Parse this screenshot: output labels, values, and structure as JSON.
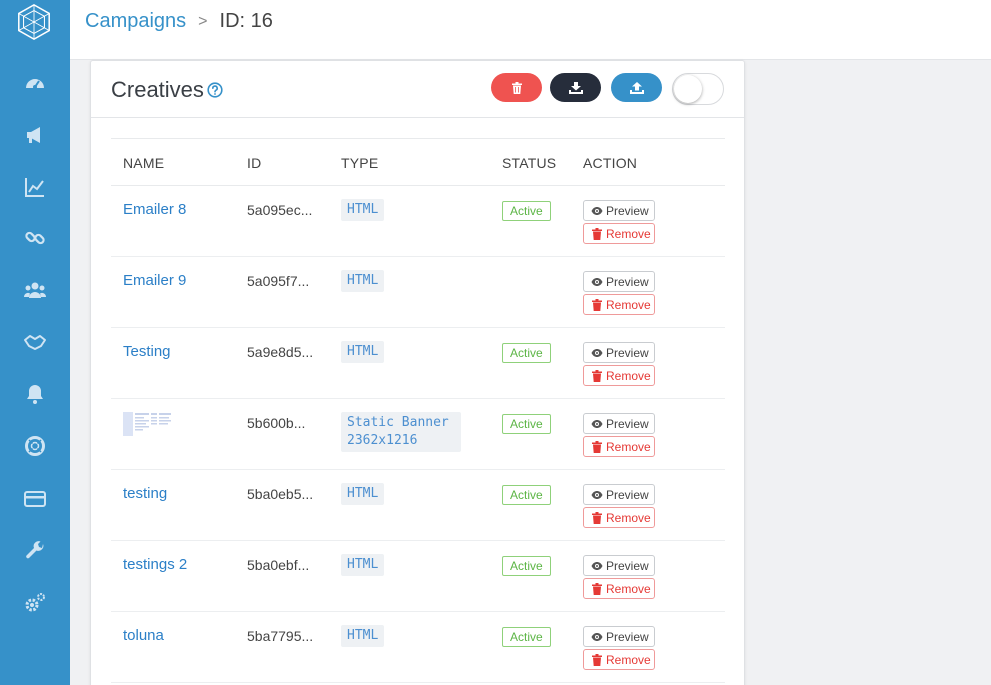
{
  "breadcrumb": {
    "parent": "Campaigns",
    "separator": ">",
    "current": "ID: 16"
  },
  "card": {
    "title": "Creatives"
  },
  "table": {
    "headers": [
      "NAME",
      "ID",
      "TYPE",
      "STATUS",
      "ACTION"
    ],
    "rows": [
      {
        "name": "Emailer 8",
        "id": "5a095ec...",
        "type": "HTML",
        "status": "Active",
        "preview": "Preview",
        "remove": "Remove"
      },
      {
        "name": "Emailer 9",
        "id": "5a095f7...",
        "type": "HTML",
        "status": "",
        "preview": "Preview",
        "remove": "Remove"
      },
      {
        "name": "Testing",
        "id": "5a9e8d5...",
        "type": "HTML",
        "status": "Active",
        "preview": "Preview",
        "remove": "Remove"
      },
      {
        "name": "",
        "id": "5b600b...",
        "type": "Static Banner 2362x1216",
        "status": "Active",
        "preview": "Preview",
        "remove": "Remove"
      },
      {
        "name": "testing",
        "id": "5ba0eb5...",
        "type": "HTML",
        "status": "Active",
        "preview": "Preview",
        "remove": "Remove"
      },
      {
        "name": "testings 2",
        "id": "5ba0ebf...",
        "type": "HTML",
        "status": "Active",
        "preview": "Preview",
        "remove": "Remove"
      },
      {
        "name": "toluna",
        "id": "5ba7795...",
        "type": "HTML",
        "status": "Active",
        "preview": "Preview",
        "remove": "Remove"
      }
    ]
  },
  "colors": {
    "sidebar": "#3691c9",
    "accent": "#3691c9",
    "danger": "#ef5350",
    "dark": "#262d3b",
    "success": "#5cb545"
  },
  "icons": {
    "sidebar": [
      "dashboard-icon",
      "megaphone-icon",
      "chart-line-icon",
      "link-icon",
      "users-icon",
      "handshake-icon",
      "bell-icon",
      "life-ring-icon",
      "credit-card-icon",
      "wrench-icon",
      "cogs-icon"
    ],
    "header": [
      "help-icon",
      "trash-icon",
      "download-icon",
      "upload-icon"
    ]
  }
}
